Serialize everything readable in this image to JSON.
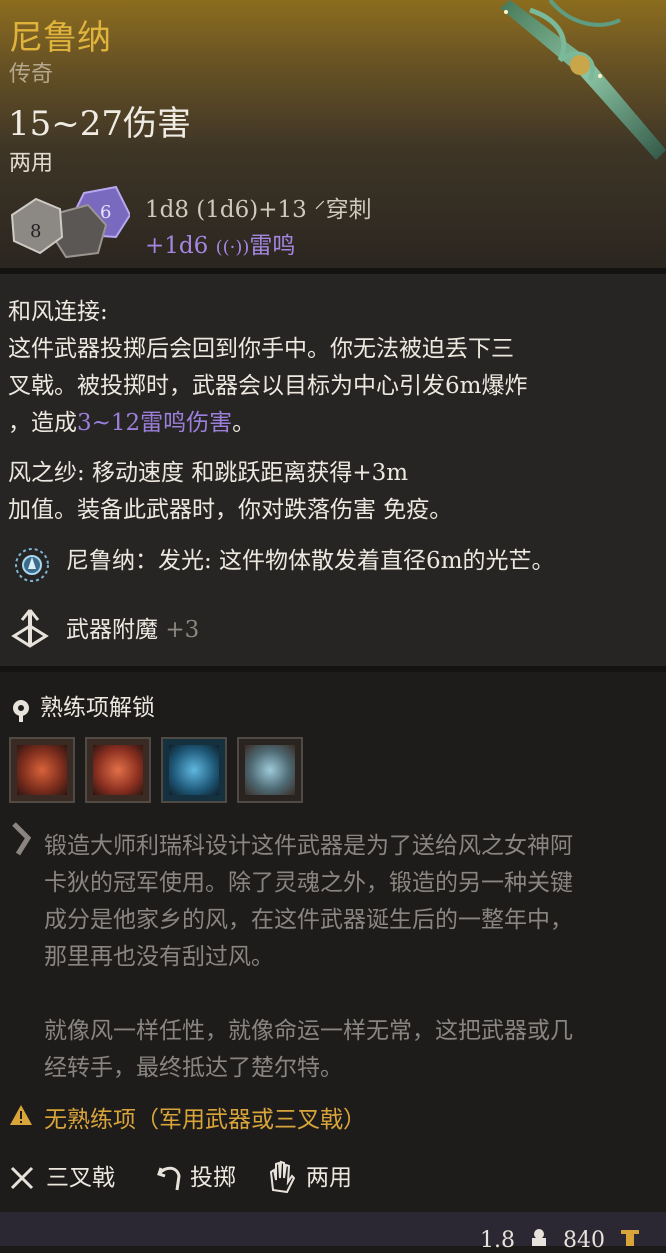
{
  "item": {
    "name": "尼鲁纳",
    "rarity": "传奇",
    "damage": "15~27伤害",
    "handedness": "两用",
    "damage_formula": "1d8 (1d6)+13",
    "damage_type": "穿刺",
    "bonus_damage": "+1d6",
    "bonus_type": "雷鸣",
    "dice": [
      "8",
      "6"
    ]
  },
  "abilities": {
    "zephyr_title": "和风连接:",
    "zephyr_line1": "这件武器投掷后会回到你手中。你无法被迫丢下三",
    "zephyr_line2": "叉戟。被投掷时，武器会以目标为中心引发6m爆炸",
    "zephyr_line3_prefix": "，造成",
    "zephyr_line3_highlight": "3~12雷鸣伤害",
    "zephyr_line3_suffix": "。",
    "wind_line1": "风之纱: 移动速度 和跳跃距离获得+3m",
    "wind_line2": "加值。装备此武器时，你对跌落伤害 免疫。",
    "light_text": "尼鲁纳：发光: 这件物体散发着直径6m的光芒。",
    "enchant_label": "武器附魔",
    "enchant_value": "+3"
  },
  "proficiency": {
    "title": "熟练项解锁",
    "icons": [
      "slash-action-icon",
      "rush-action-icon",
      "wave-action-icon",
      "wind-action-icon"
    ]
  },
  "lore": {
    "line1": "锻造大师利瑞科设计这件武器是为了送给风之女神阿",
    "line2": "卡狄的冠军使用。除了灵魂之外，锻造的另一种关键",
    "line3": "成分是他家乡的风，在这件武器诞生后的一整年中，",
    "line4": "那里再也没有刮过风。",
    "line5": "就像风一样任性，就像命运一样无常，这把武器或几",
    "line6": "经转手，最终抵达了楚尔特。"
  },
  "warning": "无熟练项（军用武器或三叉戟）",
  "tags": {
    "weapon_type": "三叉戟",
    "thrown": "投掷",
    "versatile": "两用"
  },
  "footer": {
    "weight": "1.8",
    "value": "840"
  },
  "colors": {
    "gold": "#e0b33c",
    "purple": "#9b7fdb",
    "warning": "#d9a53a"
  }
}
